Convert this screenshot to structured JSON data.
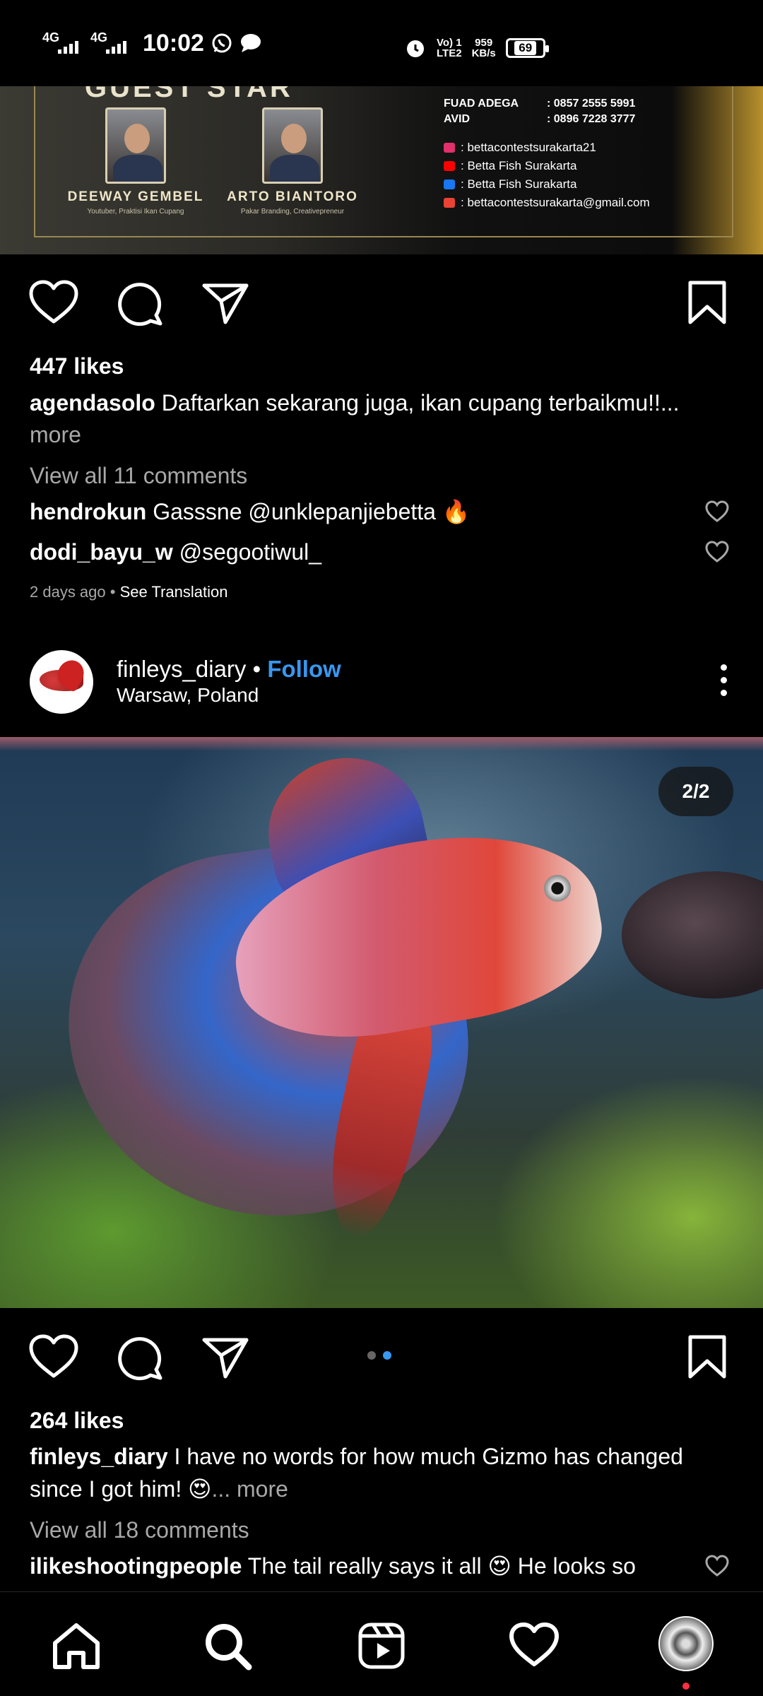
{
  "status_bar": {
    "time": "10:02",
    "net1": "4G",
    "net2": "4G",
    "volte": "Vo) 1",
    "lte": "LTE2",
    "speed_value": "959",
    "speed_unit": "KB/s",
    "battery": "69",
    "icons": [
      "signal-icon",
      "whatsapp-icon",
      "message-icon",
      "alarm-icon"
    ]
  },
  "post1": {
    "banner": {
      "heading": "GUEST STAR",
      "speakers": [
        {
          "name": "DEEWAY GEMBEL",
          "role": "Youtuber, Praktisi Ikan Cupang"
        },
        {
          "name": "ARTO BIANTORO",
          "role": "Pakar Branding, Creativepreneur"
        }
      ],
      "contacts": [
        {
          "name": "FUAD ADEGA",
          "phone": ": 0857 2555 5991"
        },
        {
          "name": "AVID",
          "phone": ": 0896 7228 3777"
        }
      ],
      "socials": [
        {
          "icon": "instagram-icon",
          "color": "#e1306c",
          "text": ": bettacontestsurakarta21"
        },
        {
          "icon": "youtube-icon",
          "color": "#ff0000",
          "text": ": Betta Fish Surakarta"
        },
        {
          "icon": "facebook-icon",
          "color": "#1877f2",
          "text": ": Betta Fish Surakarta"
        },
        {
          "icon": "mail-icon",
          "color": "#ea4335",
          "text": ": bettacontestsurakarta@gmail.com"
        }
      ]
    },
    "likes": "447 likes",
    "caption_user": "agendasolo",
    "caption_text": "Daftarkan sekarang juga, ikan cupang terbaikmu!!...",
    "more": "more",
    "view_comments": "View all 11 comments",
    "comments": [
      {
        "user": "hendrokun",
        "text": "Gasssne @unklepanjiebetta 🔥"
      },
      {
        "user": "dodi_bayu_w",
        "text": "@segootiwul_"
      }
    ],
    "time_ago": "2 days ago",
    "dot": "•",
    "translate": "See Translation"
  },
  "post2": {
    "username": "finleys_diary",
    "separator": "•",
    "follow": "Follow",
    "location": "Warsaw, Poland",
    "counter": "2/2",
    "carousel": {
      "count": 2,
      "active": 2
    },
    "likes": "264 likes",
    "caption_user": "finleys_diary",
    "caption_line1": "I have no words for how much Gizmo has changed",
    "caption_line2": "since I got him! 😍",
    "caption_more": "... more",
    "view_comments": "View all 18 comments",
    "comment_user": "ilikeshootingpeople",
    "comment_text": "The tail really says it all 😍 He looks so"
  },
  "nav": {
    "items": [
      "home-icon",
      "search-icon",
      "reels-icon",
      "activity-heart-icon",
      "profile-avatar"
    ]
  },
  "colors": {
    "accent": "#3897f0",
    "muted": "#a8a8a8",
    "notification": "#ff3040"
  }
}
